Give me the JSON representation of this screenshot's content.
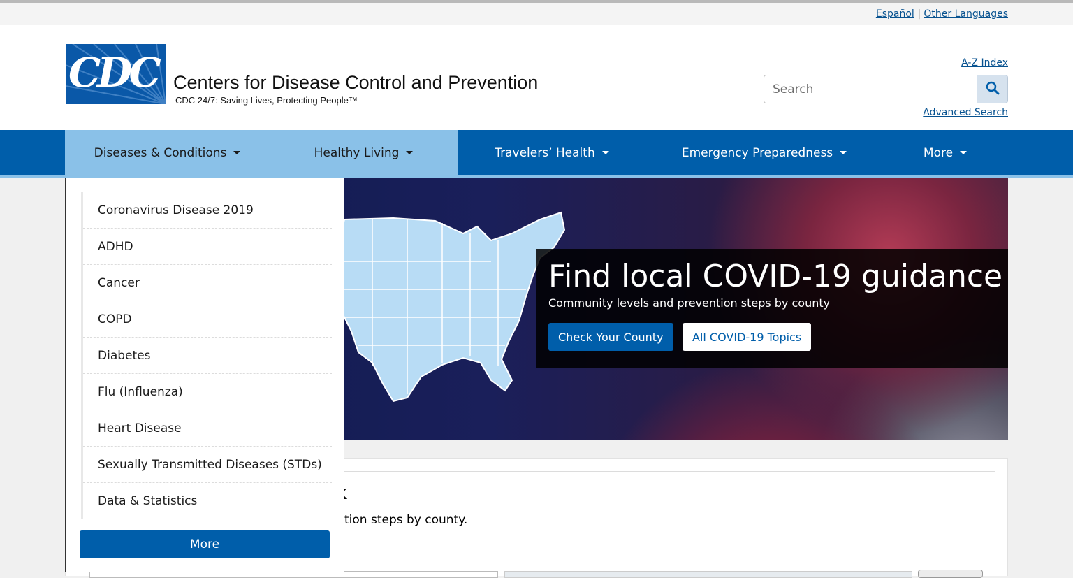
{
  "lang_bar": {
    "espanol": "Español",
    "separator": "|",
    "other": "Other Languages"
  },
  "header": {
    "logo_text": "CDC",
    "org_name": "Centers for Disease Control and Prevention",
    "tagline": "CDC 24/7: Saving Lives, Protecting People™",
    "az_index": "A-Z Index",
    "search_placeholder": "Search",
    "advanced_search": "Advanced Search"
  },
  "nav": {
    "items": [
      {
        "label": "Diseases & Conditions"
      },
      {
        "label": "Healthy Living"
      },
      {
        "label": "Travelers’ Health"
      },
      {
        "label": "Emergency Preparedness"
      },
      {
        "label": "More"
      }
    ]
  },
  "dropdown": {
    "items": [
      "Coronavirus Disease 2019",
      "ADHD",
      "Cancer",
      "COPD",
      "Diabetes",
      "Flu (Influenza)",
      "Heart Disease",
      "Sexually Transmitted Diseases (STDs)",
      "Data & Statistics"
    ],
    "more_button": "More"
  },
  "hero": {
    "title": "Find local COVID-19 guidance",
    "subtitle": "Community levels and prevention steps by county",
    "primary_button": "Check Your County",
    "secondary_button": "All COVID-19 Topics"
  },
  "card": {
    "title_visible": "k",
    "subtitle_visible": "tion steps by county."
  },
  "colors": {
    "brand_blue": "#005eaa",
    "nav_active": "#8ac1e8",
    "link": "#075290"
  },
  "icons": {
    "search": "search-icon",
    "caret": "caret-down-icon"
  }
}
